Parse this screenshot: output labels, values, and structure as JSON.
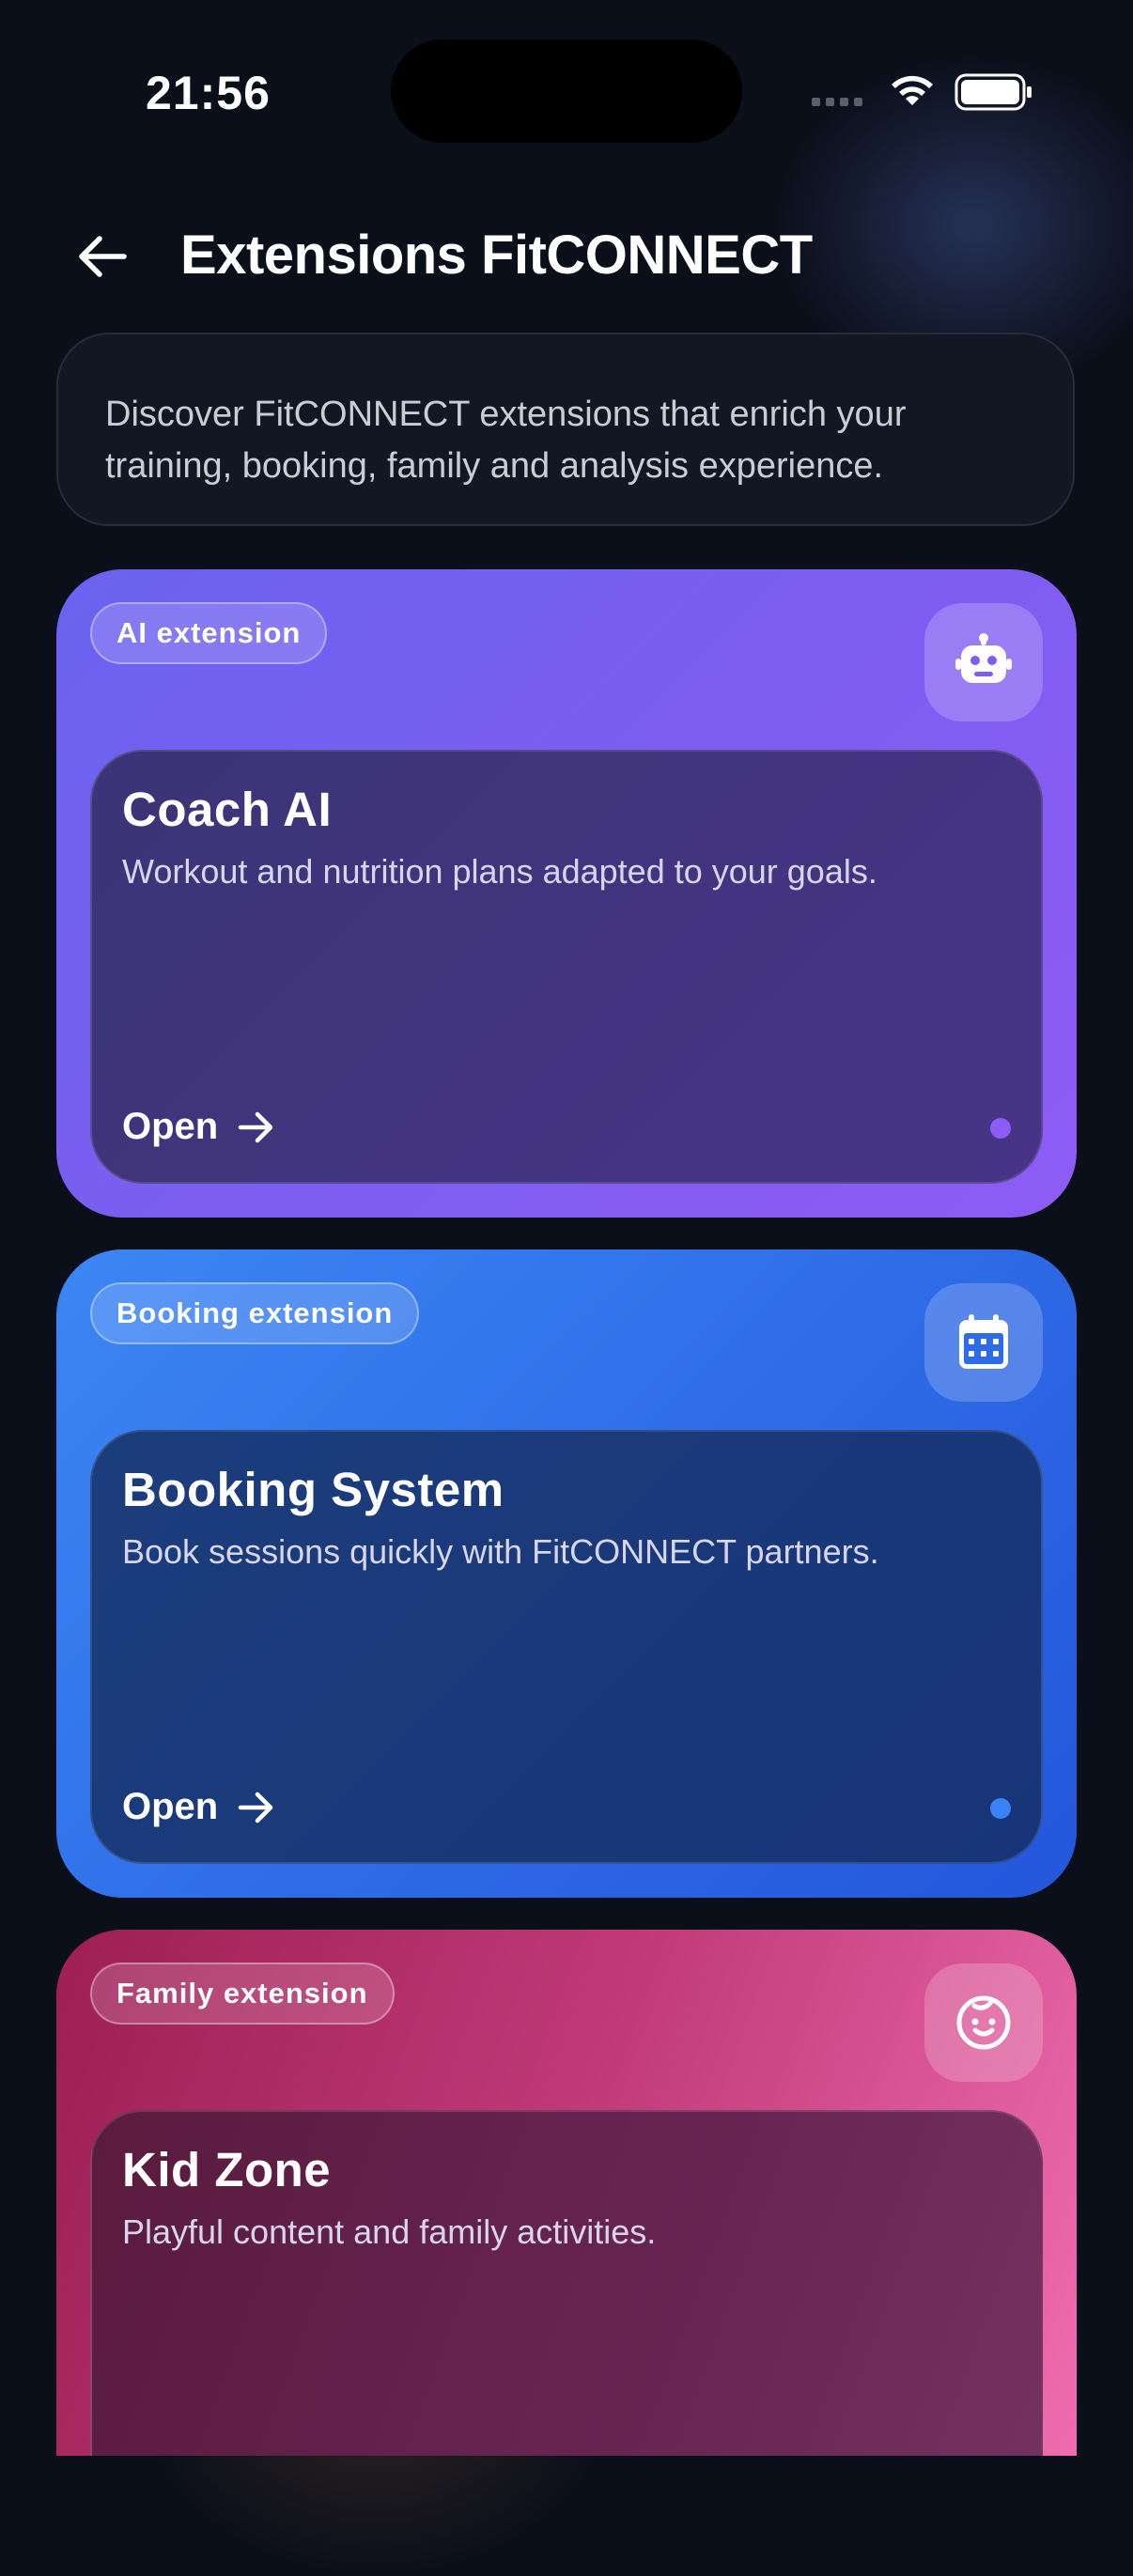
{
  "status_bar": {
    "time": "21:56"
  },
  "header": {
    "title": "Extensions FitCONNECT"
  },
  "intro": {
    "text": "Discover FitCONNECT extensions that enrich your training, booking, family and analysis experience."
  },
  "cards": [
    {
      "badge": "AI extension",
      "icon": "robot-icon",
      "title": "Coach AI",
      "description": "Workout and nutrition plans adapted to your goals.",
      "action": "Open",
      "accent": "#8b5cf6"
    },
    {
      "badge": "Booking extension",
      "icon": "calendar-icon",
      "title": "Booking System",
      "description": "Book sessions quickly with FitCONNECT partners.",
      "action": "Open",
      "accent": "#3b82f6"
    },
    {
      "badge": "Family extension",
      "icon": "baby-face-icon",
      "title": "Kid Zone",
      "description": "Playful content and family activities."
    }
  ]
}
